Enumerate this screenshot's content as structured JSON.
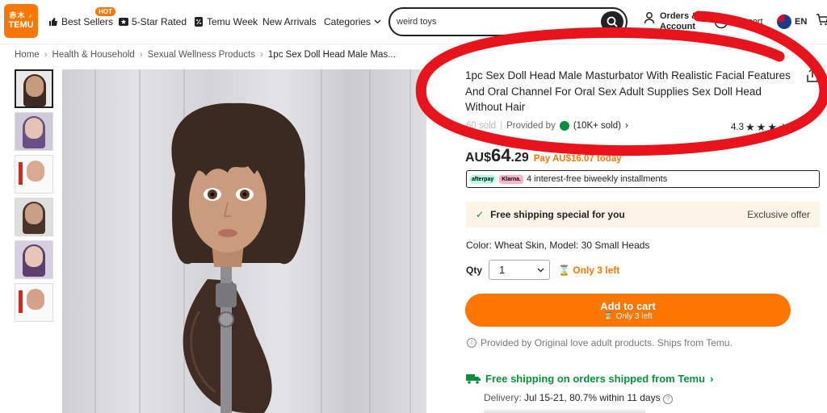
{
  "header": {
    "logo_glyphs": "赤木 ♪",
    "logo_text": "TEMU",
    "nav": [
      {
        "label": "Best Sellers",
        "icon": "thumbs-up-icon"
      },
      {
        "label": "5-Star Rated",
        "icon": "star-badge-icon"
      },
      {
        "label": "Temu Week",
        "icon": "percent-tag-icon"
      },
      {
        "label": "New Arrivals",
        "icon": ""
      },
      {
        "label": "Categories",
        "icon": "chevron-down-icon"
      }
    ],
    "hot_badge": "HOT",
    "search_value": "weird toys",
    "orders_line1": "Orders &",
    "orders_line2": "Account",
    "support": "Support",
    "lang": "EN"
  },
  "breadcrumb": [
    "Home",
    "Health & Household",
    "Sexual Wellness Products",
    "1pc Sex Doll Head Male Mas..."
  ],
  "product": {
    "title": "1pc Sex Doll Head Male Masturbator With Realistic Facial Features And Oral Channel For Oral Sex Adult Supplies Sex Doll Head Without Hair",
    "sold": "60 sold",
    "provided_by": "Provided by",
    "provider_sold": "(10K+ sold)",
    "rating": "4.3",
    "rating_stars": 4.3,
    "price_currency": "AU$",
    "price_main": "64",
    "price_decimal": ".29",
    "pay_today": "Pay AU$16.07 today",
    "afterpay": "afterpay",
    "klarna": "Klarna.",
    "installments": "4 interest-free biweekly installments",
    "free_shipping_special": "Free shipping special for you",
    "exclusive_offer": "Exclusive offer",
    "color_model": "Color: Wheat Skin, Model: 30 Small Heads",
    "qty_label": "Qty",
    "qty_value": "1",
    "only_left": "Only 3 left",
    "add_to_cart": "Add to cart",
    "add_to_cart_sub": "Only 3 left",
    "provided_note": "Provided by Original love adult products. Ships from Temu.",
    "free_ship_orders": "Free shipping on orders shipped from Temu",
    "delivery_label": "Delivery:",
    "delivery_value": "Jul 15-21, 80.7% within 11 days"
  },
  "colors": {
    "accent": "#fb7701",
    "green": "#0a8f3c",
    "annotation_red": "#e8141c"
  }
}
